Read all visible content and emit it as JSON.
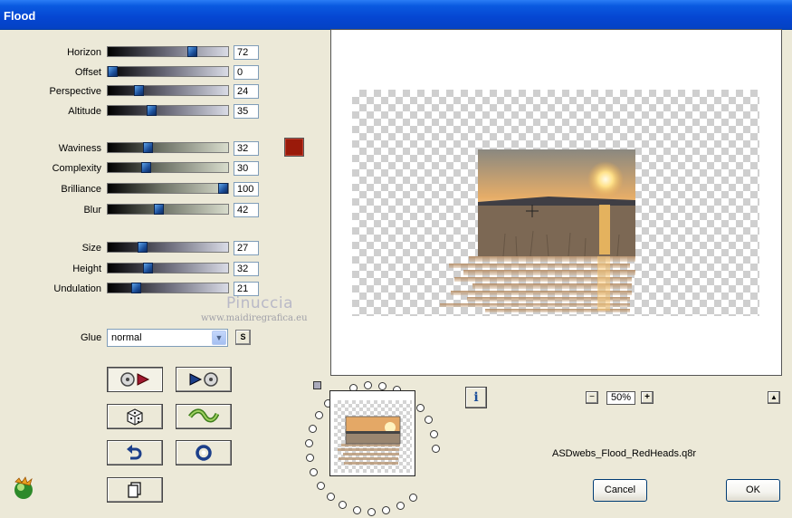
{
  "window": {
    "title": "Flood"
  },
  "params": [
    {
      "label": "Horizon",
      "value": "72",
      "level": 0.72
    },
    {
      "label": "Offset",
      "value": "0",
      "level": 0.0
    },
    {
      "label": "Perspective",
      "value": "24",
      "level": 0.24
    },
    {
      "label": "Altitude",
      "value": "35",
      "level": 0.35
    },
    {
      "label": "Waviness",
      "value": "32",
      "level": 0.32
    },
    {
      "label": "Complexity",
      "value": "30",
      "level": 0.3
    },
    {
      "label": "Brilliance",
      "value": "100",
      "level": 1.0
    },
    {
      "label": "Blur",
      "value": "42",
      "level": 0.42
    },
    {
      "label": "Size",
      "value": "27",
      "level": 0.27
    },
    {
      "label": "Height",
      "value": "32",
      "level": 0.32
    },
    {
      "label": "Undulation",
      "value": "21",
      "level": 0.21
    }
  ],
  "flood_color": "#9a1a0a",
  "watermark": {
    "name": "Pinuccia",
    "url": "www.maidiregrafica.eu"
  },
  "glue": {
    "label": "Glue",
    "value": "normal",
    "s_label": "S"
  },
  "tools": [
    "load-preset-icon",
    "save-preset-icon",
    "randomize-dice-icon",
    "wave-icon",
    "undo-icon",
    "reset-icon",
    "copy-icon"
  ],
  "zoom": {
    "value": "50%",
    "minus": "−",
    "plus": "+"
  },
  "info_label": "i",
  "up_label": "▲",
  "preset_file": "ASDwebs_Flood_RedHeads.q8r",
  "buttons": {
    "cancel": "Cancel",
    "ok": "OK"
  }
}
